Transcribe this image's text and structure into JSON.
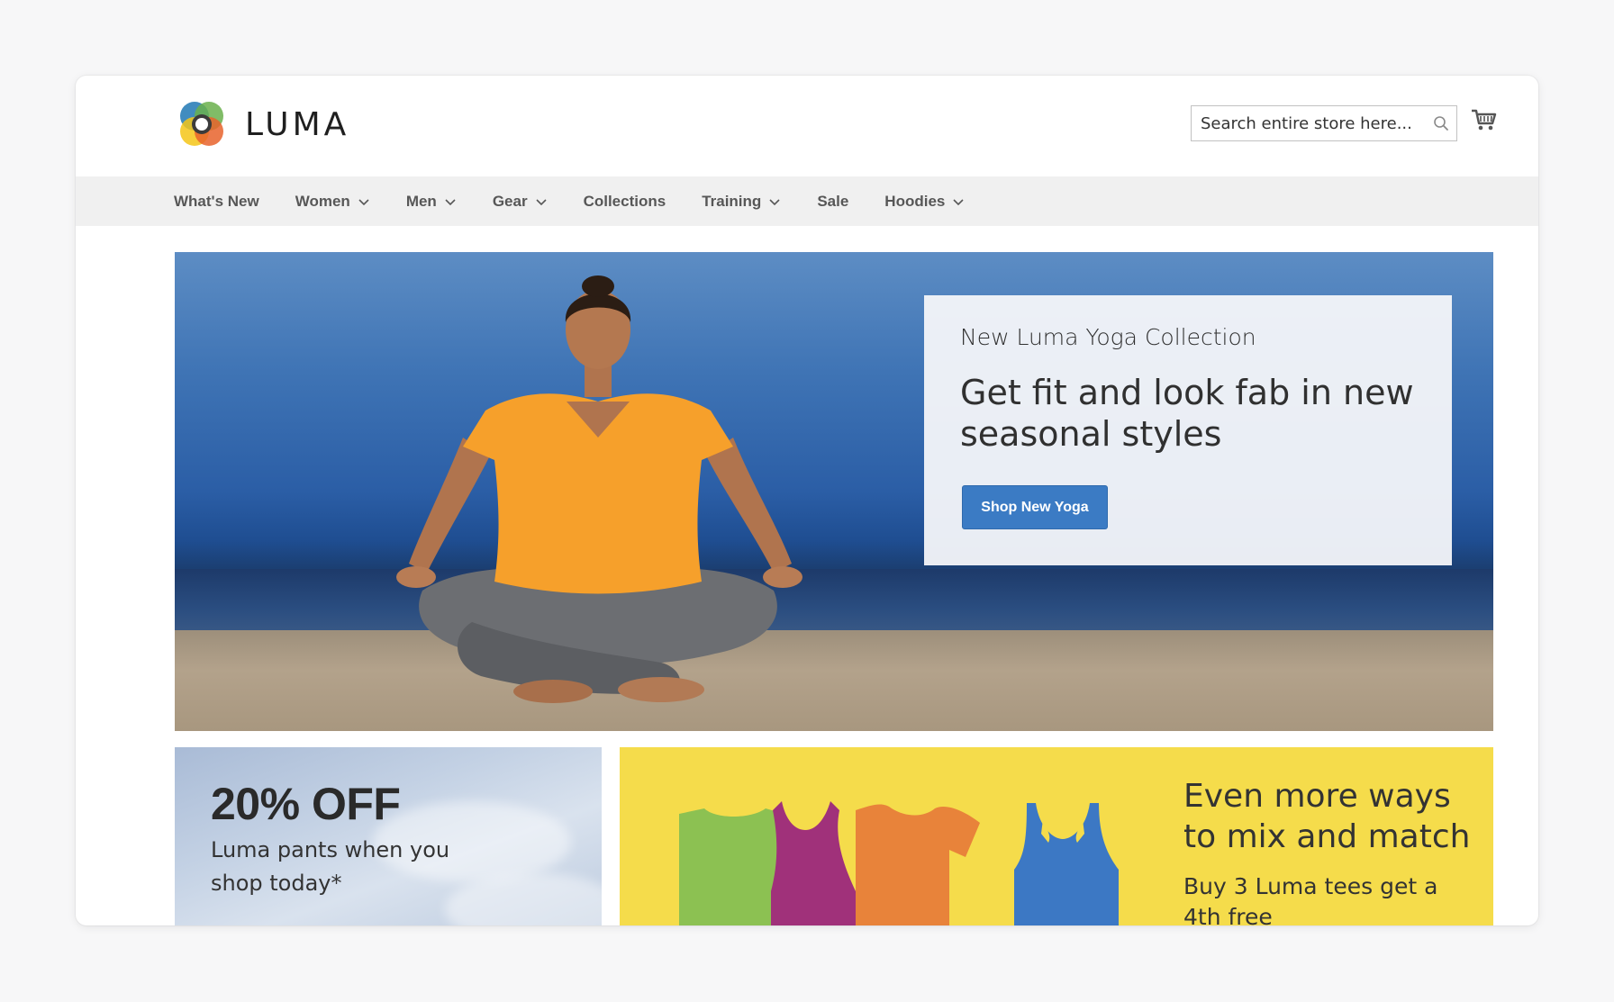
{
  "brand": {
    "name": "LUMA",
    "logo_icon": "luma-logo-icon"
  },
  "search": {
    "placeholder": "Search entire store here..."
  },
  "nav": {
    "items": [
      {
        "label": "What's New",
        "has_dropdown": false
      },
      {
        "label": "Women",
        "has_dropdown": true
      },
      {
        "label": "Men",
        "has_dropdown": true
      },
      {
        "label": "Gear",
        "has_dropdown": true
      },
      {
        "label": "Collections",
        "has_dropdown": false
      },
      {
        "label": "Training",
        "has_dropdown": true
      },
      {
        "label": "Sale",
        "has_dropdown": false
      },
      {
        "label": "Hoodies",
        "has_dropdown": true
      }
    ]
  },
  "hero": {
    "kicker": "New Luma Yoga Collection",
    "headline": "Get fit and look fab in new seasonal styles",
    "button_label": "Shop New Yoga",
    "button_color": "#3b7bc4"
  },
  "promo_left": {
    "title": "20% OFF",
    "text": "Luma pants when you shop today*"
  },
  "promo_right": {
    "title": "Even more ways to mix and match",
    "text": "Buy 3 Luma tees get a 4th free",
    "background": "#f5dc4b"
  },
  "colors": {
    "nav_bg": "#f0f0f0",
    "accent": "#3b7bc4"
  }
}
